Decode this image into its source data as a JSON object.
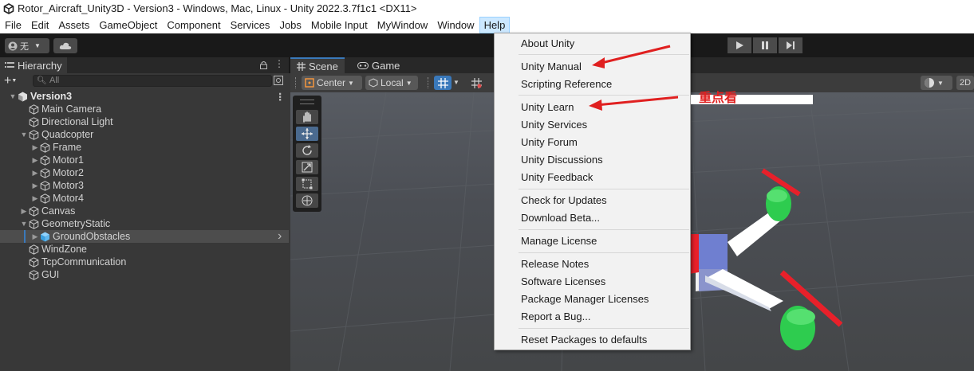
{
  "window": {
    "title": "Rotor_Aircraft_Unity3D - Version3 - Windows, Mac, Linux - Unity 2022.3.7f1c1 <DX11>"
  },
  "menubar": {
    "items": [
      "File",
      "Edit",
      "Assets",
      "GameObject",
      "Component",
      "Services",
      "Jobs",
      "Mobile Input",
      "MyWindow",
      "Window",
      "Help"
    ],
    "active": "Help"
  },
  "toolbar": {
    "account_label": "无"
  },
  "hierarchy": {
    "tab_label": "Hierarchy",
    "search_placeholder": "All",
    "rows": [
      {
        "label": "Version3",
        "depth": 0,
        "expanded": true,
        "bold": true,
        "icon": "unity-scene-icon"
      },
      {
        "label": "Main Camera",
        "depth": 1,
        "icon": "gameobject-icon"
      },
      {
        "label": "Directional Light",
        "depth": 1,
        "icon": "gameobject-icon"
      },
      {
        "label": "Quadcopter",
        "depth": 1,
        "expanded": true,
        "icon": "gameobject-icon"
      },
      {
        "label": "Frame",
        "depth": 2,
        "collapsed": true,
        "icon": "gameobject-icon"
      },
      {
        "label": "Motor1",
        "depth": 2,
        "collapsed": true,
        "icon": "gameobject-icon"
      },
      {
        "label": "Motor2",
        "depth": 2,
        "collapsed": true,
        "icon": "gameobject-icon"
      },
      {
        "label": "Motor3",
        "depth": 2,
        "collapsed": true,
        "icon": "gameobject-icon"
      },
      {
        "label": "Motor4",
        "depth": 2,
        "collapsed": true,
        "icon": "gameobject-icon"
      },
      {
        "label": "Canvas",
        "depth": 1,
        "collapsed": true,
        "icon": "gameobject-icon"
      },
      {
        "label": "GeometryStatic",
        "depth": 1,
        "expanded": true,
        "icon": "gameobject-icon"
      },
      {
        "label": "GroundObstacles",
        "depth": 2,
        "collapsed": true,
        "selected": true,
        "icon": "prefab-icon"
      },
      {
        "label": "WindZone",
        "depth": 1,
        "icon": "gameobject-icon"
      },
      {
        "label": "TcpCommunication",
        "depth": 1,
        "icon": "gameobject-icon"
      },
      {
        "label": "GUI",
        "depth": 1,
        "icon": "gameobject-icon"
      }
    ]
  },
  "scene": {
    "tabs": [
      "Scene",
      "Game"
    ],
    "pivot_label": "Center",
    "space_label": "Local",
    "mode_2d": "2D"
  },
  "help_menu": {
    "groups": [
      [
        "About Unity"
      ],
      [
        "Unity Manual",
        "Scripting Reference"
      ],
      [
        "Unity Learn",
        "Unity Services",
        "Unity Forum",
        "Unity Discussions",
        "Unity Feedback"
      ],
      [
        "Check for Updates",
        "Download Beta..."
      ],
      [
        "Manage License"
      ],
      [
        "Release Notes",
        "Software Licenses",
        "Package Manager Licenses",
        "Report a Bug..."
      ],
      [
        "Reset Packages to defaults"
      ]
    ]
  },
  "annotation": {
    "text": "重点看",
    "color": "#e02020"
  },
  "colors": {
    "selection": "#4d4d4d",
    "menu_active": "#cce8ff",
    "scene_tab_accent": "#3a79bb"
  }
}
